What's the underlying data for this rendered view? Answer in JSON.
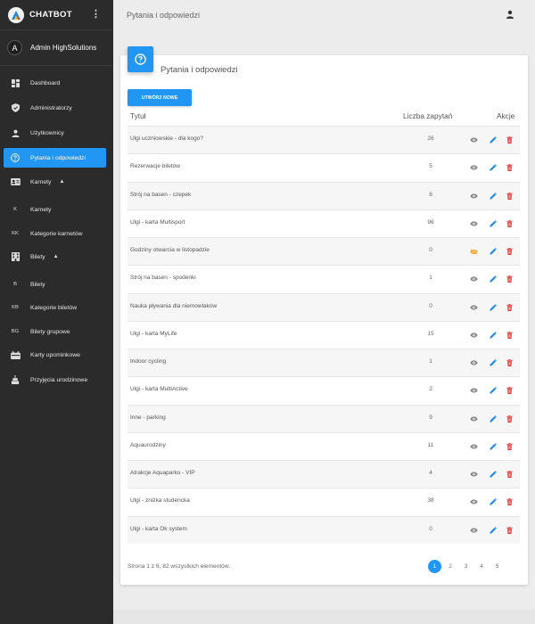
{
  "app": {
    "name": "CHATBOT",
    "menu_glyph": "⋮"
  },
  "user": {
    "initial": "A",
    "name": "Admin HighSolutions"
  },
  "colors": {
    "accent": "#2196f3",
    "sidebar": "#2b2b2b",
    "delete": "#e53935",
    "edit": "#1e88e5",
    "hidden": "#f5a623"
  },
  "sidebar": {
    "items": [
      {
        "label": "Dashboard",
        "icon": "dashboard-icon"
      },
      {
        "label": "Administratorzy",
        "icon": "shield-icon"
      },
      {
        "label": "Użytkownicy",
        "icon": "person-icon"
      },
      {
        "label": "Pytania i odpowiedzi",
        "icon": "help-circle-icon",
        "active": true
      },
      {
        "label": "Karnety",
        "icon": "card-icon",
        "expandable": true,
        "caret": "▲"
      },
      {
        "label": "Karnety",
        "abbr": "K"
      },
      {
        "label": "Kategorie karnetów",
        "abbr": "KK"
      },
      {
        "label": "Bilety",
        "icon": "building-icon",
        "expandable": true,
        "caret": "▲"
      },
      {
        "label": "Bilety",
        "abbr": "B"
      },
      {
        "label": "Kategorie biletów",
        "abbr": "KB"
      },
      {
        "label": "Bilety grupowe",
        "abbr": "BG"
      },
      {
        "label": "Karty upominkowe",
        "icon": "gift-card-icon"
      },
      {
        "label": "Przyjęcia urodzinowe",
        "icon": "cake-icon"
      }
    ]
  },
  "topbar": {
    "title": "Pytania i odpowiedzi"
  },
  "card": {
    "title": "Pytania i odpowiedzi",
    "create_label": "UTWÓRZ NOWE",
    "columns": {
      "title": "Tytuł",
      "count": "Liczba zapytań",
      "actions": "Akcje"
    },
    "rows": [
      {
        "title": "Ulgi uczniowskie - dla kogo?",
        "count": "26",
        "hidden": false
      },
      {
        "title": "Rezerwacje biletów",
        "count": "5",
        "hidden": false
      },
      {
        "title": "Strój na basen - czepek",
        "count": "8",
        "hidden": false
      },
      {
        "title": "Ulgi - karta Multisport",
        "count": "96",
        "hidden": false
      },
      {
        "title": "Godziny otwarcia w listopadzie",
        "count": "0",
        "hidden": true
      },
      {
        "title": "Strój na basen - spodenki",
        "count": "1",
        "hidden": false
      },
      {
        "title": "Nauka pływania dla niemowlaków",
        "count": "0",
        "hidden": false
      },
      {
        "title": "Ulgi - karta MyLife",
        "count": "15",
        "hidden": false
      },
      {
        "title": "Indoor cycling",
        "count": "1",
        "hidden": false
      },
      {
        "title": "Ulgi - karta MultiActive",
        "count": "2",
        "hidden": false
      },
      {
        "title": "Inne - parking",
        "count": "9",
        "hidden": false
      },
      {
        "title": "Aquaurodziny",
        "count": "11",
        "hidden": false
      },
      {
        "title": "Atrakcje Aquaparku - VIP",
        "count": "4",
        "hidden": false
      },
      {
        "title": "Ulgi - zniżka studencka",
        "count": "38",
        "hidden": false
      },
      {
        "title": "Ulgi - karta Ok system",
        "count": "0",
        "hidden": false
      }
    ],
    "footer": "Strona 1 z 6, 82 wszystkich elementów.",
    "pages": [
      "1",
      "2",
      "3",
      "4",
      "5"
    ],
    "current_page": "1"
  }
}
